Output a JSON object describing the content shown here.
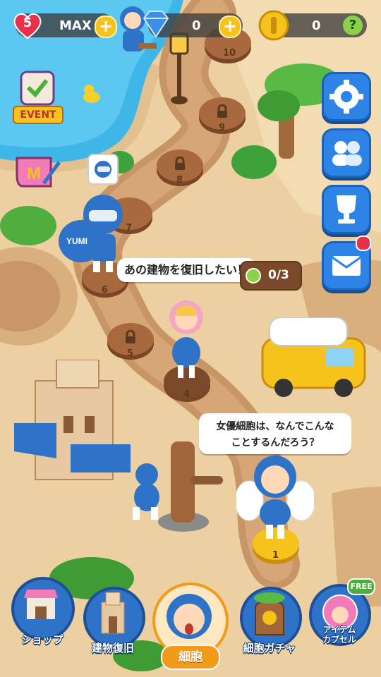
{
  "topbar": {
    "lives": "5",
    "lives_status": "MAX",
    "gems": "0",
    "coins": "0",
    "help": "?"
  },
  "side": {
    "event_label": "EVENT"
  },
  "map": {
    "nodes": [
      "10",
      "9",
      "8",
      "7",
      "6",
      "5",
      "4",
      "1"
    ],
    "quest_progress": "0/3",
    "bubble1": "あの建物を復旧したい！",
    "bubble2_line1": "女優細胞は、なんでこんな",
    "bubble2_line2": "ことするんだろう？",
    "char_name": "YUMI"
  },
  "nav": {
    "shop": "ショップ",
    "building": "建物復旧",
    "cells": "細胞",
    "gacha": "細胞ガチャ",
    "item_line1": "アイテム",
    "item_line2": "カプセル",
    "free_badge": "FREE"
  },
  "colors": {
    "accent_blue": "#2d84e6",
    "sand": "#e9c99c",
    "path": "#c89566",
    "water": "#3fb6e8",
    "gold": "#f6c21c"
  }
}
